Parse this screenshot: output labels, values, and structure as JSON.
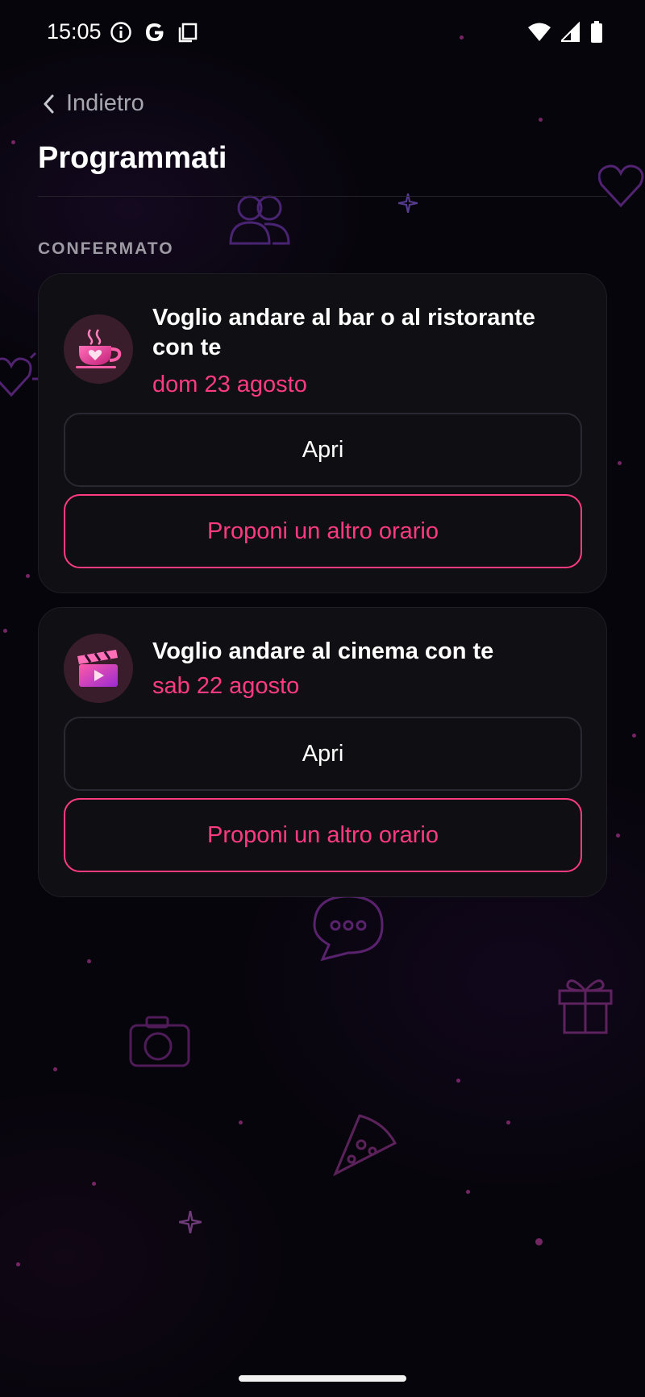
{
  "status_bar": {
    "time": "15:05",
    "left_icons": [
      "info-icon",
      "google-icon",
      "copy-icon"
    ],
    "right_icons": [
      "wifi-icon",
      "signal-icon",
      "battery-icon"
    ]
  },
  "header": {
    "back_label": "Indietro",
    "title": "Programmati"
  },
  "section": {
    "label": "CONFERMATO"
  },
  "events": [
    {
      "icon": "coffee-cup-icon",
      "title": "Voglio andare al bar o al ristorante con te",
      "date": "dom 23 agosto",
      "open_label": "Apri",
      "propose_label": "Proponi un altro orario"
    },
    {
      "icon": "clapperboard-icon",
      "title": "Voglio andare al cinema con te",
      "date": "sab 22 agosto",
      "open_label": "Apri",
      "propose_label": "Proponi un altro orario"
    }
  ],
  "colors": {
    "background": "#07050c",
    "accent": "#ff3b80",
    "card": "#111014",
    "muted_text": "#a7a7b0"
  }
}
